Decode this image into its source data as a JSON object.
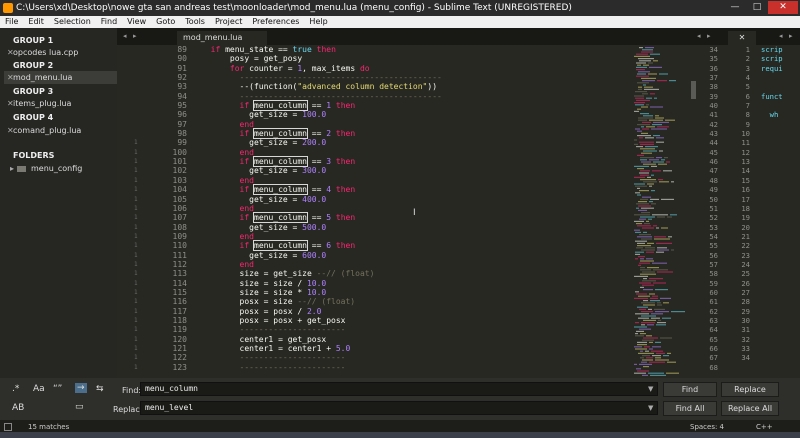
{
  "window": {
    "title": "C:\\Users\\xd\\Desktop\\nowe gta san andreas test\\moonloader\\mod_menu.lua (menu_config) - Sublime Text (UNREGISTERED)",
    "controls": [
      "—",
      "□",
      "✕"
    ]
  },
  "menu": [
    "File",
    "Edit",
    "Selection",
    "Find",
    "View",
    "Goto",
    "Tools",
    "Project",
    "Preferences",
    "Help"
  ],
  "sidebar": {
    "groups": [
      {
        "label": "GROUP 1",
        "file": "opcodes lua.cpp"
      },
      {
        "label": "GROUP 2",
        "file": "mod_menu.lua"
      },
      {
        "label": "GROUP 3",
        "file": "items_plug.lua"
      },
      {
        "label": "GROUP 4",
        "file": "comand_plug.lua"
      }
    ],
    "folders_heading": "FOLDERS",
    "folder": "menu_config"
  },
  "tabs": {
    "active": "mod_menu.lua",
    "close_glyph": "✕"
  },
  "editor": {
    "line_numbers": [
      "89",
      "90",
      "91",
      "92",
      "93",
      "94",
      "95",
      "96",
      "97",
      "98",
      "99",
      "100",
      "101",
      "102",
      "103",
      "104",
      "105",
      "106",
      "107",
      "108",
      "109",
      "110",
      "111",
      "112",
      "113",
      "114",
      "115",
      "116",
      "117",
      "118",
      "119",
      "120",
      "121",
      "122",
      "123"
    ],
    "fold_marks": [
      "",
      "",
      "",
      "",
      "",
      "",
      "",
      "",
      "",
      "",
      "1",
      "1",
      "1",
      "1",
      "1",
      "1",
      "1",
      "1",
      "1",
      "1",
      "1",
      "1",
      "1",
      "1",
      "1",
      "1",
      "1",
      "1",
      "1",
      "1",
      "1",
      "1",
      "1",
      "1",
      "1"
    ],
    "lines": [
      [
        [
          "",
          "  "
        ],
        [
          "kw",
          "if"
        ],
        [
          "",
          " menu_state == "
        ],
        [
          "fn",
          "true"
        ],
        [
          "",
          " "
        ],
        [
          "kw",
          "then"
        ]
      ],
      [
        [
          "",
          "      posy = get_posy"
        ]
      ],
      [
        [
          "",
          "      "
        ],
        [
          "kw",
          "for"
        ],
        [
          "",
          " counter = "
        ],
        [
          "num",
          "1"
        ],
        [
          "",
          ", max_items "
        ],
        [
          "kw",
          "do"
        ]
      ],
      [
        [
          "cm",
          "        ------------------------------------------"
        ]
      ],
      [
        [
          "",
          "        --(function("
        ],
        [
          "str",
          "\"advanced column detection\""
        ],
        [
          "",
          ")"
        ],
        [
          "",
          ")"
        ]
      ],
      [
        [
          "cm",
          "        ------------------------------------------"
        ]
      ],
      [
        [
          "",
          "        "
        ],
        [
          "kw",
          "if"
        ],
        [
          "",
          " "
        ],
        [
          "hl",
          "menu_column"
        ],
        [
          "",
          " == "
        ],
        [
          "num",
          "1"
        ],
        [
          "",
          " "
        ],
        [
          "kw",
          "then"
        ]
      ],
      [
        [
          "",
          "          get_size = "
        ],
        [
          "num",
          "100.0"
        ]
      ],
      [
        [
          "",
          "        "
        ],
        [
          "kw",
          "end"
        ]
      ],
      [
        [
          "",
          "        "
        ],
        [
          "kw",
          "if"
        ],
        [
          "",
          " "
        ],
        [
          "hl",
          "menu_column"
        ],
        [
          "",
          " == "
        ],
        [
          "num",
          "2"
        ],
        [
          "",
          " "
        ],
        [
          "kw",
          "then"
        ]
      ],
      [
        [
          "",
          "          get_size = "
        ],
        [
          "num",
          "200.0"
        ]
      ],
      [
        [
          "",
          "        "
        ],
        [
          "kw",
          "end"
        ]
      ],
      [
        [
          "",
          "        "
        ],
        [
          "kw",
          "if"
        ],
        [
          "",
          " "
        ],
        [
          "hl",
          "menu_column"
        ],
        [
          "",
          " == "
        ],
        [
          "num",
          "3"
        ],
        [
          "",
          " "
        ],
        [
          "kw",
          "then"
        ]
      ],
      [
        [
          "",
          "          get_size = "
        ],
        [
          "num",
          "300.0"
        ]
      ],
      [
        [
          "",
          "        "
        ],
        [
          "kw",
          "end"
        ]
      ],
      [
        [
          "",
          "        "
        ],
        [
          "kw",
          "if"
        ],
        [
          "",
          " "
        ],
        [
          "hl",
          "menu_column"
        ],
        [
          "",
          " == "
        ],
        [
          "num",
          "4"
        ],
        [
          "",
          " "
        ],
        [
          "kw",
          "then"
        ]
      ],
      [
        [
          "",
          "          get_size = "
        ],
        [
          "num",
          "400.0"
        ]
      ],
      [
        [
          "",
          "        "
        ],
        [
          "kw",
          "end"
        ]
      ],
      [
        [
          "",
          "        "
        ],
        [
          "kw",
          "if"
        ],
        [
          "",
          " "
        ],
        [
          "hl",
          "menu_column"
        ],
        [
          "",
          " == "
        ],
        [
          "num",
          "5"
        ],
        [
          "",
          " "
        ],
        [
          "kw",
          "then"
        ]
      ],
      [
        [
          "",
          "          get_size = "
        ],
        [
          "num",
          "500.0"
        ]
      ],
      [
        [
          "",
          "        "
        ],
        [
          "kw",
          "end"
        ]
      ],
      [
        [
          "",
          "        "
        ],
        [
          "kw",
          "if"
        ],
        [
          "",
          " "
        ],
        [
          "hl",
          "menu_column"
        ],
        [
          "",
          " == "
        ],
        [
          "num",
          "6"
        ],
        [
          "",
          " "
        ],
        [
          "kw",
          "then"
        ]
      ],
      [
        [
          "",
          "          get_size = "
        ],
        [
          "num",
          "600.0"
        ]
      ],
      [
        [
          "",
          "        "
        ],
        [
          "kw",
          "end"
        ]
      ],
      [
        [
          "",
          "        size = get_size "
        ],
        [
          "cm",
          "--// (float)"
        ]
      ],
      [
        [
          "",
          "        size = size / "
        ],
        [
          "num",
          "10.0"
        ]
      ],
      [
        [
          "",
          "        size = size * "
        ],
        [
          "num",
          "10.0"
        ]
      ],
      [
        [
          "",
          "        posx = size "
        ],
        [
          "cm",
          "--// (float)"
        ]
      ],
      [
        [
          "",
          "        posx = posx / "
        ],
        [
          "num",
          "2.0"
        ]
      ],
      [
        [
          "",
          "        posx = posx + get_posx"
        ]
      ],
      [
        [
          "cm",
          "        ----------------------"
        ]
      ],
      [
        [
          "",
          "        center1 = get_posx"
        ]
      ],
      [
        [
          "",
          "        center1 = center1 + "
        ],
        [
          "num",
          "5.0"
        ]
      ],
      [
        [
          "cm",
          "        ----------------------"
        ]
      ],
      [
        [
          "cm",
          "        ----------------------"
        ]
      ]
    ]
  },
  "pane2": {
    "line_numbers": [
      "34",
      "35",
      "36",
      "37",
      "38",
      "39",
      "40",
      "41",
      "42",
      "43",
      "44",
      "45",
      "46",
      "47",
      "48",
      "49",
      "50",
      "51",
      "52",
      "53",
      "54",
      "55",
      "56",
      "57",
      "58",
      "59",
      "60",
      "61",
      "62",
      "63",
      "64",
      "65",
      "66",
      "67",
      "68"
    ]
  },
  "pane3": {
    "close_glyph": "✕",
    "line_numbers": [
      "1",
      "2",
      "3",
      "4",
      "5",
      "6",
      "7",
      "8",
      "9",
      "10",
      "11",
      "12",
      "13",
      "14",
      "15",
      "16",
      "17",
      "18",
      "19",
      "20",
      "21",
      "22",
      "23",
      "24",
      "25",
      "26",
      "27",
      "28",
      "29",
      "30",
      "31",
      "32",
      "33",
      "34"
    ],
    "lines": [
      "scrip",
      "scrip",
      "requi",
      "",
      "",
      "funct",
      "",
      "  wh",
      "",
      "",
      "",
      "",
      "",
      "",
      "",
      "",
      "",
      "",
      "",
      "",
      "",
      "",
      "",
      "",
      "",
      "",
      "",
      "",
      "",
      "",
      "",
      "",
      "",
      ""
    ]
  },
  "find": {
    "options": [
      ".*",
      "Aa",
      "“”",
      "→",
      "⇆",
      "AB",
      "▭"
    ],
    "find_label": "Find:",
    "find_value": "menu_column",
    "replace_label": "Replace:",
    "replace_value": "menu_level",
    "find_button": "Find",
    "replace_button": "Replace",
    "find_all_button": "Find All",
    "replace_all_button": "Replace All"
  },
  "status": {
    "matches": "15 matches",
    "spaces": "Spaces: 4",
    "syntax": "C++"
  }
}
